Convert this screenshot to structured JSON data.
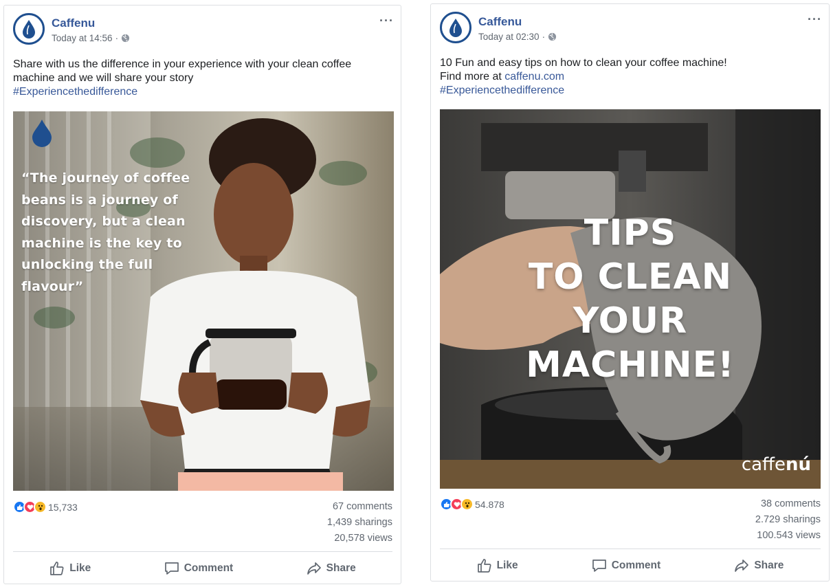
{
  "posts": [
    {
      "page_name": "Caffenu",
      "timestamp": "Today at 14:56",
      "text_line": "Share with us the difference in your experience with your clean coffee machine and we will share your story",
      "hashtag": "#Experiencethedifference",
      "image_quote": "“The journey of coffee beans is a journey of discovery, but a clean machine is the key to unlocking the full flavour”",
      "reaction_count": "15,733",
      "comments": "67 comments",
      "sharings": "1,439 sharings",
      "views": "20,578 views",
      "actions": {
        "like": "Like",
        "comment": "Comment",
        "share": "Share"
      }
    },
    {
      "page_name": "Caffenu",
      "timestamp": "Today at 02:30",
      "text_line": "10 Fun and easy tips on how to clean your coffee machine!",
      "find_more_prefix": "Find more at ",
      "link": "caffenu.com",
      "hashtag": "#Experiencethedifference",
      "image_title": [
        "TIPS",
        "TO CLEAN",
        "YOUR",
        "MACHINE!"
      ],
      "watermark": {
        "light": "caffe",
        "bold": "nú"
      },
      "reaction_count": "54.878",
      "comments": "38 comments",
      "sharings": "2.729 sharings",
      "views": "100.543 views",
      "actions": {
        "like": "Like",
        "comment": "Comment",
        "share": "Share"
      }
    }
  ],
  "colors": {
    "brand_blue": "#1f4f8f",
    "link_blue": "#385898",
    "like_blue": "#1877f2",
    "love_red": "#f33e58",
    "wow_yellow": "#f7b928"
  },
  "icons": [
    "caffenu-drop-logo",
    "globe-icon",
    "more-dots-icon",
    "like-reaction-icon",
    "love-reaction-icon",
    "wow-reaction-icon",
    "thumbs-up-icon",
    "comment-bubble-icon",
    "share-arrow-icon"
  ]
}
